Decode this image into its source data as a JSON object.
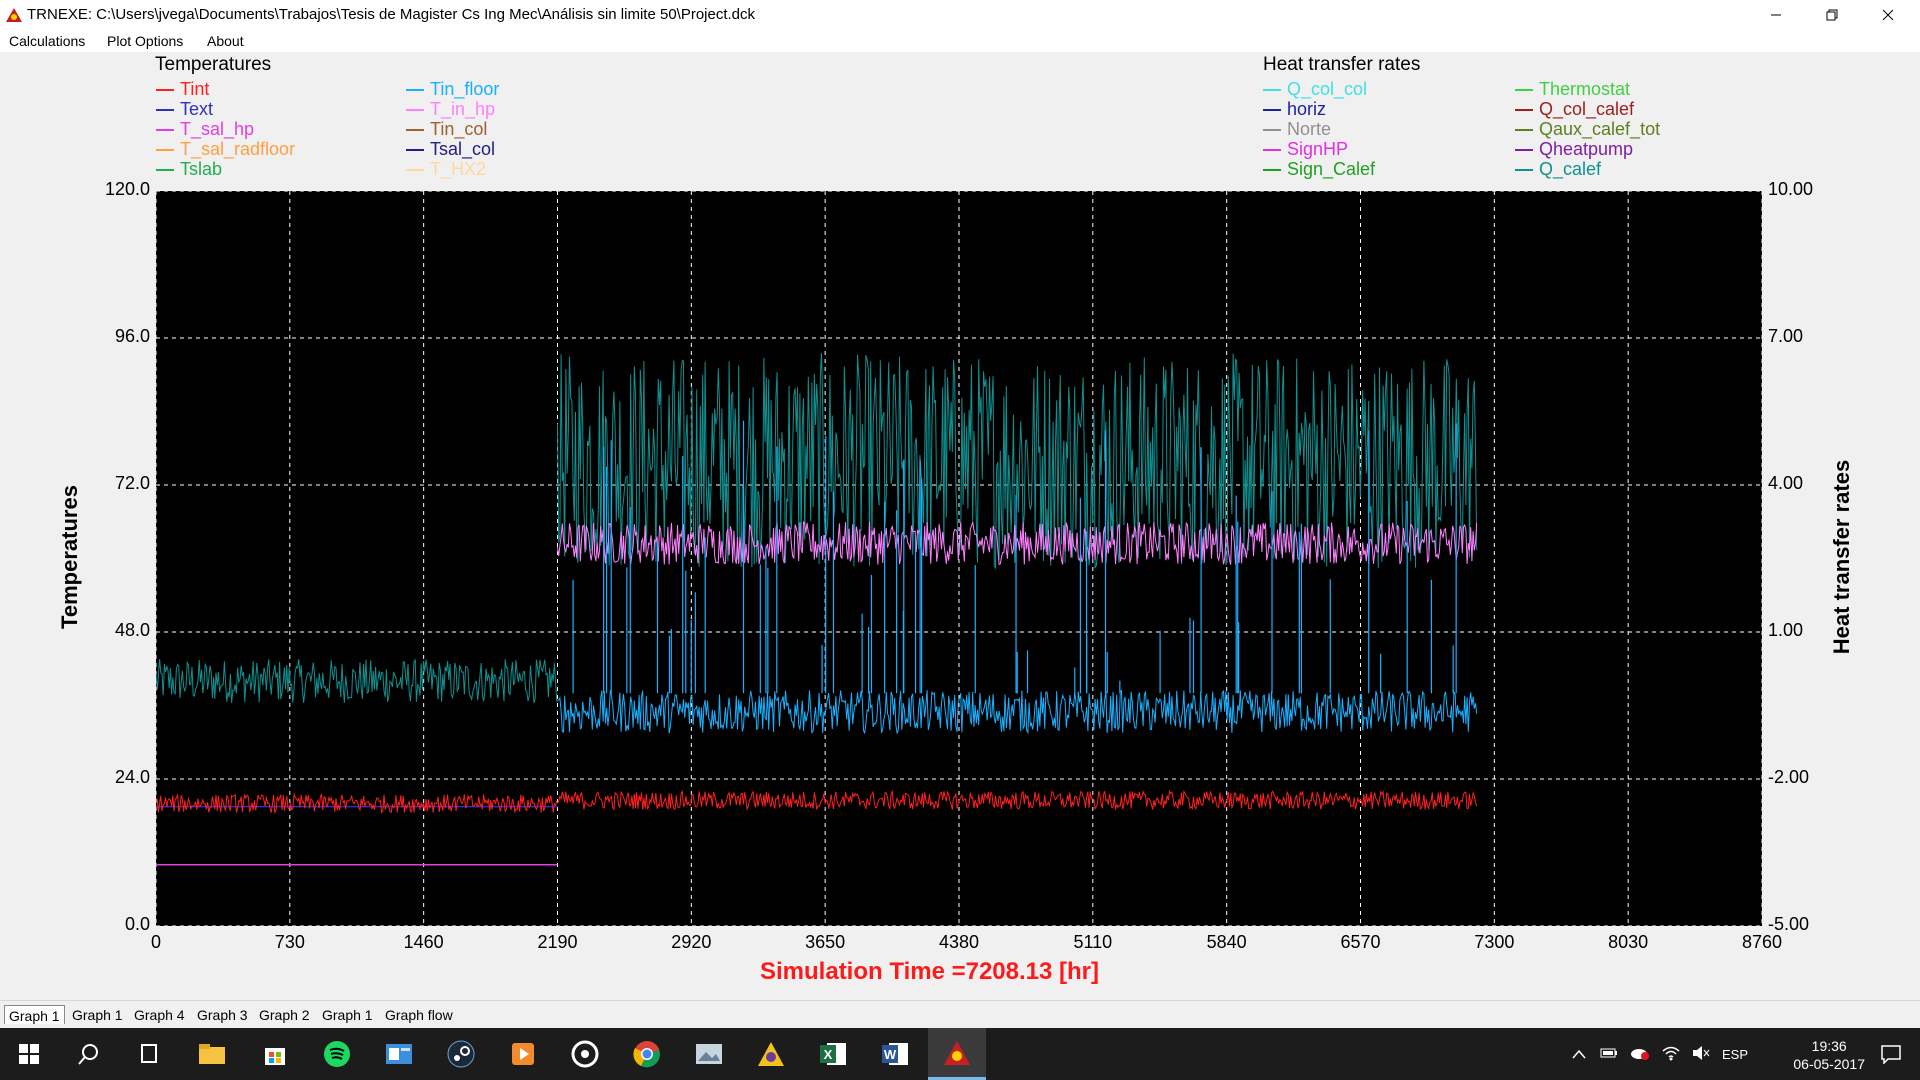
{
  "window": {
    "title": "TRNEXE: C:\\Users\\jvega\\Documents\\Trabajos\\Tesis de Magister  Cs Ing Mec\\Análisis sin limite 50\\Project.dck",
    "controls": [
      "minimize-icon",
      "restore-icon",
      "close-icon"
    ]
  },
  "menu": {
    "items": [
      "Calculations",
      "Plot Options",
      "About"
    ]
  },
  "legend": {
    "temperatures_title": "Temperatures",
    "temperatures": [
      {
        "label": "Tint",
        "color": "#ff2020"
      },
      {
        "label": "Text",
        "color": "#3030c0"
      },
      {
        "label": "T_sal_hp",
        "color": "#e040e0"
      },
      {
        "label": "T_sal_radfloor",
        "color": "#ffa040"
      },
      {
        "label": "Tslab",
        "color": "#20b050"
      },
      {
        "label": "Tin_floor",
        "color": "#1ab0ff"
      },
      {
        "label": "T_in_hp",
        "color": "#ff80ff"
      },
      {
        "label": "Tin_col",
        "color": "#a06030"
      },
      {
        "label": "Tsal_col",
        "color": "#202080"
      },
      {
        "label": "T_HX2",
        "color": "#ffd8a0"
      }
    ],
    "heat_title": "Heat transfer rates",
    "heat": [
      {
        "label": "Q_col_col",
        "color": "#40e0e0"
      },
      {
        "label": "horiz",
        "color": "#2020a0"
      },
      {
        "label": "Norte",
        "color": "#909090"
      },
      {
        "label": "SignHP",
        "color": "#e030e0"
      },
      {
        "label": "Sign_Calef",
        "color": "#20a020"
      },
      {
        "label": "Thermostat",
        "color": "#40d040"
      },
      {
        "label": "Q_col_calef",
        "color": "#a02020"
      },
      {
        "label": "Qaux_calef_tot",
        "color": "#608020"
      },
      {
        "label": "Qheatpump",
        "color": "#8020a0"
      },
      {
        "label": "Q_calef",
        "color": "#109090"
      }
    ]
  },
  "chart_data": {
    "type": "line",
    "xlabel": "Simulation Time =7208.13 [hr]",
    "ylabel": "Temperatures",
    "y2label": "Heat transfer rates",
    "xlim": [
      0,
      8760
    ],
    "ylim": [
      0,
      120
    ],
    "y2lim": [
      -5,
      10
    ],
    "x_ticks": [
      "0",
      "730",
      "1460",
      "2190",
      "2920",
      "3650",
      "4380",
      "5110",
      "5840",
      "6570",
      "7300",
      "8030",
      "8760"
    ],
    "y_ticks": [
      "0.0",
      "24.0",
      "48.0",
      "72.0",
      "96.0",
      "120.0"
    ],
    "y2_ticks": [
      "-5.00",
      "-2.00",
      "1.00",
      "4.00",
      "7.00",
      "10.00"
    ],
    "grid": true,
    "background": "#000000",
    "current_time": 7208.13,
    "series": [
      {
        "name": "Tint",
        "color": "#ff2020",
        "segments": [
          {
            "x": [
              0,
              2190
            ],
            "mean": 20,
            "amp": 1.5
          },
          {
            "x": [
              2190,
              7208
            ],
            "mean": 20.5,
            "amp": 1.5
          }
        ]
      },
      {
        "name": "Text",
        "color": "#3030c0",
        "segments": [
          {
            "x": [
              0,
              2190
            ],
            "mean": 19.5,
            "amp": 0
          }
        ]
      },
      {
        "name": "T_sal_hp",
        "color": "#e040e0",
        "segments": [
          {
            "x": [
              0,
              2190
            ],
            "mean": 10,
            "amp": 0
          }
        ]
      },
      {
        "name": "Tin_floor",
        "color": "#1ab0ff",
        "segments": [
          {
            "x": [
              2190,
              7208
            ],
            "mean": 35,
            "amp": 3.5
          }
        ]
      },
      {
        "name": "T_in_hp",
        "color": "#ff80ff",
        "segments": [
          {
            "x": [
              2190,
              7208
            ],
            "mean": 62.5,
            "amp": 3.5
          }
        ]
      },
      {
        "name": "Q_calef",
        "color": "#109090",
        "segments": [
          {
            "x": [
              0,
              2190
            ],
            "mean": 0.0,
            "amp": 0.45,
            "axis": "y2"
          },
          {
            "x": [
              2190,
              7208
            ],
            "mean": 4.5,
            "amp": 2.2,
            "axis": "y2"
          }
        ]
      }
    ]
  },
  "tabs": [
    "Graph 1",
    "Graph 1",
    "Graph 4",
    "Graph 3",
    "Graph 2",
    "Graph 1",
    "Graph flow"
  ],
  "taskbar": {
    "apps": [
      "start-icon",
      "search-icon",
      "task-view-icon",
      "file-explorer-icon",
      "store-icon",
      "spotify-icon",
      "outlook-icon",
      "steam-icon",
      "media-player-icon",
      "groove-icon",
      "chrome-icon",
      "photos-icon",
      "trnsys-studio-icon",
      "excel-icon",
      "word-icon",
      "trnexe-icon"
    ],
    "language": "ESP",
    "time": "19:36",
    "date": "06-05-2017"
  }
}
